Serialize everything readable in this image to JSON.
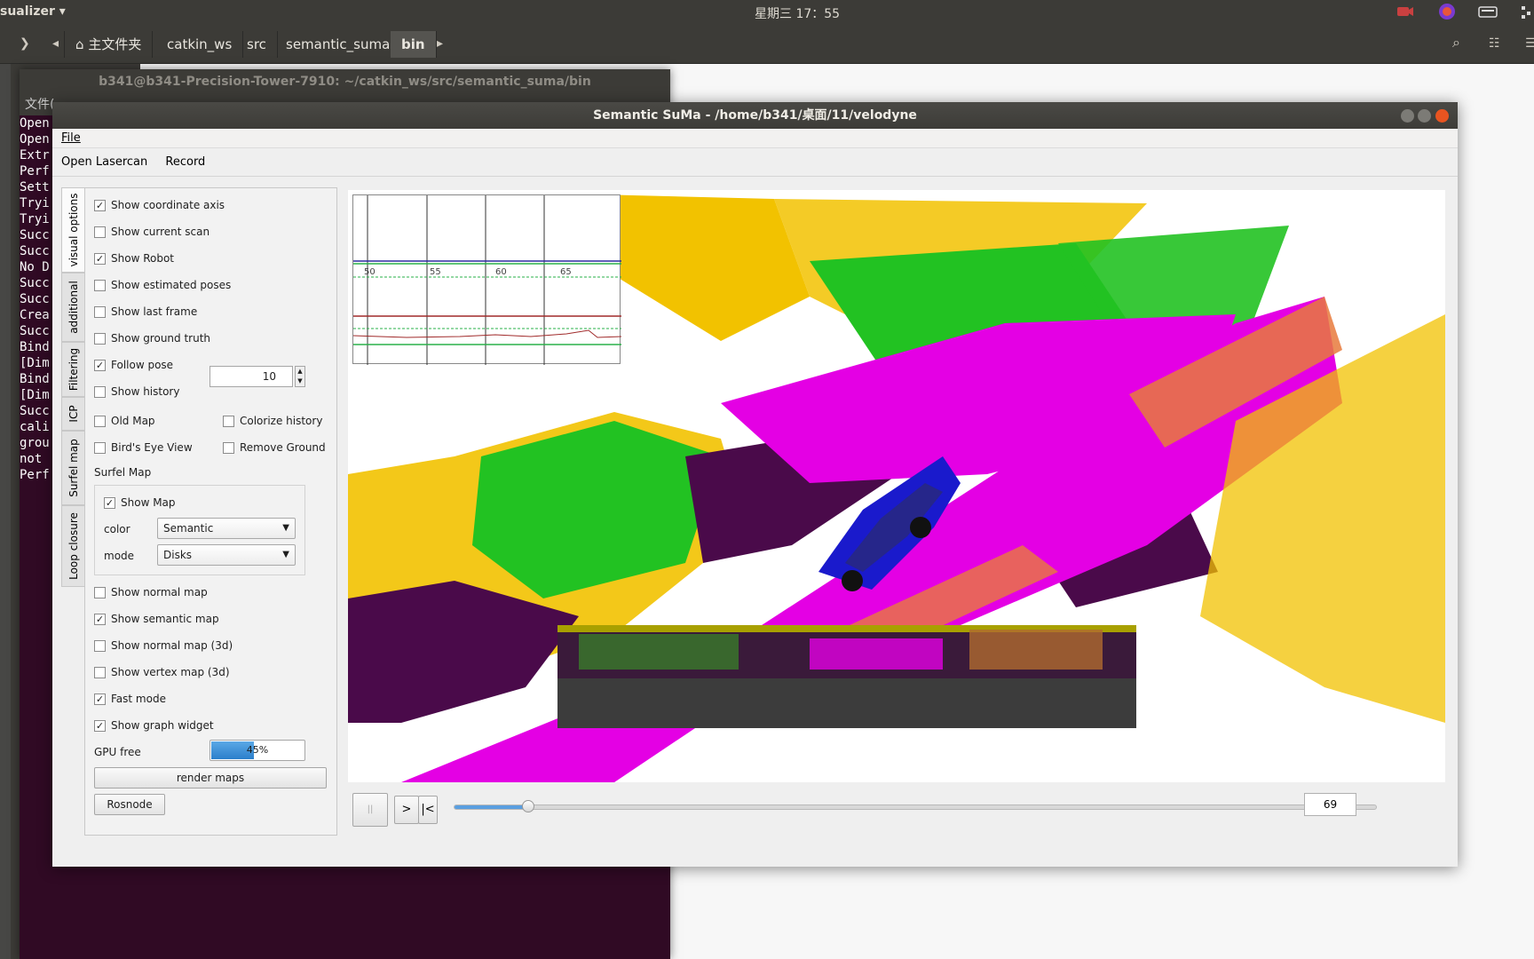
{
  "topbar": {
    "app_name": "sualizer ▾",
    "clock": "星期三 17：55"
  },
  "nav": {
    "crumbs": [
      "主文件夹",
      "catkin_ws",
      "src",
      "semantic_suma",
      "bin"
    ]
  },
  "terminal": {
    "title": "b341@b341-Precision-Tower-7910: ~/catkin_ws/src/semantic_suma/bin",
    "menu": "文件(",
    "lines": [
      "Open",
      "Open",
      "Extr",
      "Perf",
      "Sett",
      "Tryi",
      "Tryi",
      "Succ",
      "Succ",
      "No D",
      "Succ",
      "Succ",
      "Crea",
      "Succ",
      "Bind",
      "[Dim",
      "Bind",
      "[Dim",
      "Succ",
      "cali",
      "grou",
      "not ",
      "Perf"
    ]
  },
  "window": {
    "title": "Semantic SuMa - /home/b341/桌面/11/velodyne",
    "menu_file": "File",
    "tool_open": "Open Lasercan",
    "tool_record": "Record"
  },
  "tabs": [
    "visual options",
    "additional",
    "Filtering",
    "ICP",
    "Surfel map",
    "Loop closure"
  ],
  "options": {
    "coord_axis": "Show coordinate axis",
    "current_scan": "Show current scan",
    "robot": "Show Robot",
    "estimated_poses": "Show estimated poses",
    "last_frame": "Show last frame",
    "ground_truth": "Show ground truth",
    "follow_pose": "Follow pose",
    "history": "Show history",
    "history_value": "10",
    "old_map": "Old Map",
    "colorize_history": "Colorize history",
    "birds_eye": "Bird's Eye View",
    "remove_ground": "Remove Ground",
    "surfel_map": "Surfel Map",
    "show_map": "Show Map",
    "color_label": "color",
    "color_value": "Semantic",
    "mode_label": "mode",
    "mode_value": "Disks",
    "normal_map": "Show normal map",
    "semantic_map": "Show semantic map",
    "normal_map_3d": "Show normal map (3d)",
    "vertex_map_3d": "Show vertex map (3d)",
    "fast_mode": "Fast mode",
    "graph_widget": "Show graph widget",
    "gpu_free": "GPU free",
    "gpu_value": "45%",
    "gpu_fraction": 0.45,
    "render_maps": "render maps",
    "rosnode": "Rosnode"
  },
  "graph": {
    "ticks": [
      "50",
      "55",
      "60",
      "65"
    ]
  },
  "player": {
    "pause": "||",
    "next": ">",
    "first": "|<",
    "frame": "69",
    "progress": 0.08
  },
  "colors": {
    "magenta": "#e400e4",
    "green": "#22c222",
    "yellow": "#f2c200",
    "purple": "#4a0a4a",
    "car": "#1a1acc",
    "orange": "#e87a3c"
  }
}
